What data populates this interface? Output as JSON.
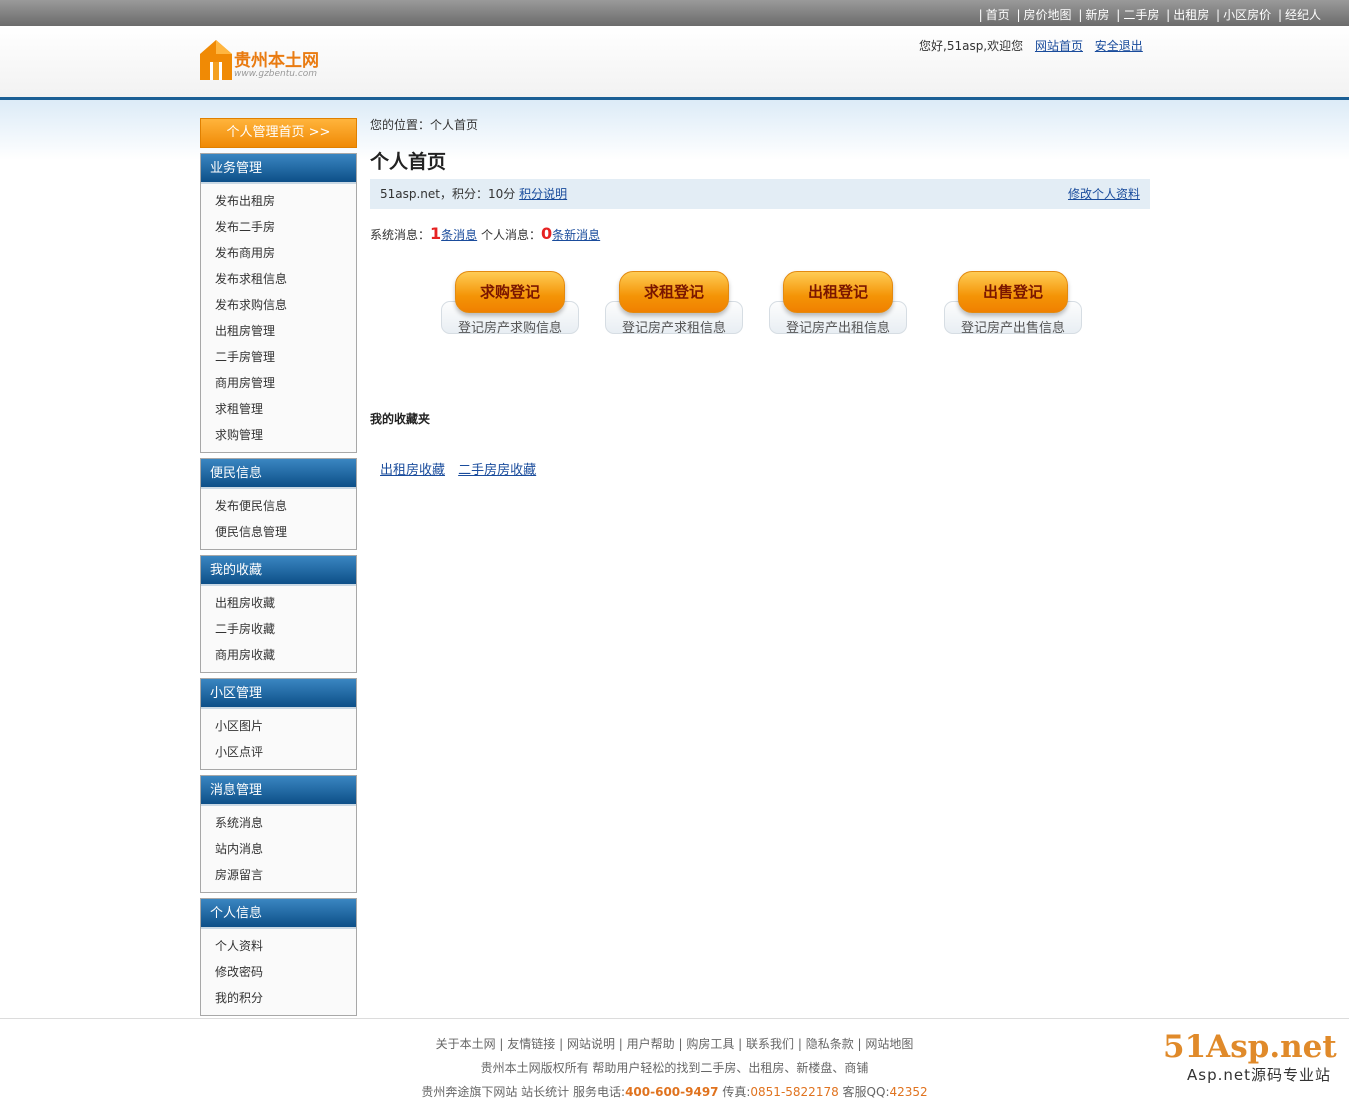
{
  "top_nav": [
    "首页",
    "房价地图",
    "新房",
    "二手房",
    "出租房",
    "小区房价",
    "经纪人"
  ],
  "logo": {
    "name": "贵州本土网",
    "sub": "www.gzbentu.com"
  },
  "header": {
    "welcome": "您好,51asp,欢迎您",
    "home_link": "网站首页",
    "logout_link": "安全退出"
  },
  "sidebar": {
    "home_button": "个人管理首页 >>",
    "groups": [
      {
        "title": "业务管理",
        "items": [
          "发布出租房",
          "发布二手房",
          "发布商用房",
          "发布求租信息",
          "发布求购信息",
          "出租房管理",
          "二手房管理",
          "商用房管理",
          "求租管理",
          "求购管理"
        ]
      },
      {
        "title": "便民信息",
        "items": [
          "发布便民信息",
          "便民信息管理"
        ]
      },
      {
        "title": "我的收藏",
        "items": [
          "出租房收藏",
          "二手房收藏",
          "商用房收藏"
        ]
      },
      {
        "title": "小区管理",
        "items": [
          "小区图片",
          "小区点评"
        ]
      },
      {
        "title": "消息管理",
        "items": [
          "系统消息",
          "站内消息",
          "房源留言"
        ]
      },
      {
        "title": "个人信息",
        "items": [
          "个人资料",
          "修改密码",
          "我的积分"
        ]
      }
    ]
  },
  "main": {
    "breadcrumb": "您的位置：个人首页",
    "title": "个人首页",
    "info": {
      "text": "51asp.net，积分：10分",
      "points_link": "积分说明",
      "edit_link": "修改个人资料"
    },
    "messages": {
      "system_label": "系统消息：",
      "system_count": "1",
      "system_suffix": "条消息",
      "personal_label": "个人消息：",
      "personal_count": "0",
      "personal_suffix": "条新消息"
    },
    "actions": [
      {
        "label": "求购登记",
        "desc": "登记房产求购信息"
      },
      {
        "label": "求租登记",
        "desc": "登记房产求租信息"
      },
      {
        "label": "出租登记",
        "desc": "登记房产出租信息"
      },
      {
        "label": "出售登记",
        "desc": "登记房产出售信息"
      }
    ],
    "favorites_title": "我的收藏夹",
    "favorites_links": [
      "出租房收藏",
      "二手房房收藏"
    ]
  },
  "footer": {
    "links": [
      "关于本土网",
      "友情链接",
      "网站说明",
      "用户帮助",
      "购房工具",
      "联系我们",
      "隐私条款",
      "网站地图"
    ],
    "copyright": "贵州本土网版权所有 帮助用户轻松的找到二手房、出租房、新楼盘、商铺",
    "contact_prefix": "贵州奔途旗下网站",
    "stats": "站长统计",
    "phone_label": "服务电话:",
    "phone": "400-600-9497",
    "fax_label": "传真:",
    "fax": "0851-5822178",
    "qq_label": "客服QQ:",
    "qq": "42352"
  },
  "watermark": {
    "big": "51Asp.net",
    "small": "Asp.net源码专业站"
  }
}
